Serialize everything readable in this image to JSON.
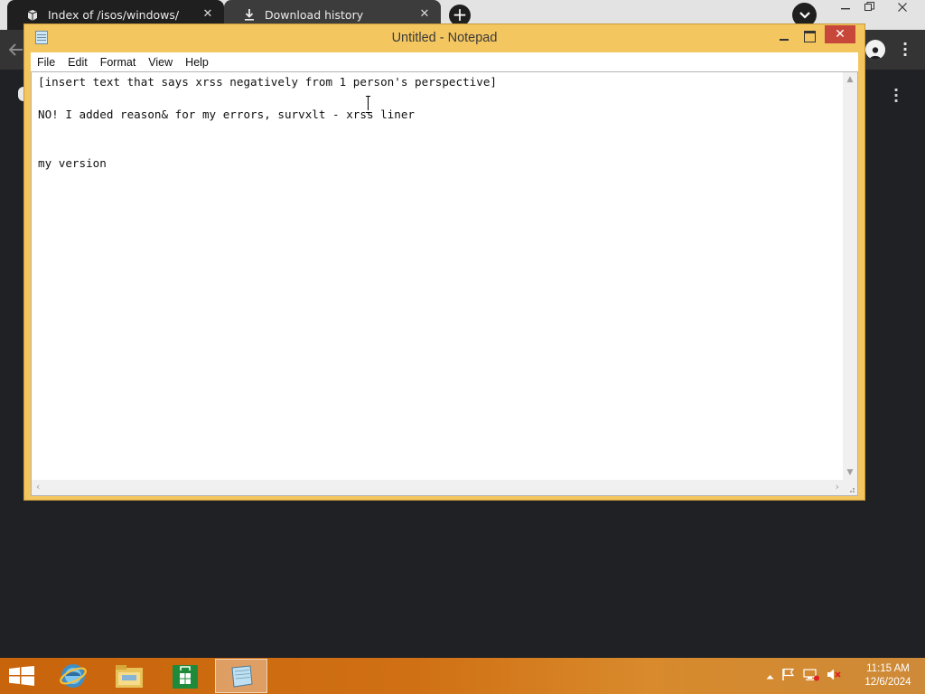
{
  "browser": {
    "tabs": [
      {
        "title": "Index of /isos/windows/",
        "icon": "archive-icon",
        "active": true
      },
      {
        "title": "Download history",
        "icon": "download-icon",
        "active": false
      }
    ],
    "new_tab_icon": "+",
    "close_glyph": "✕"
  },
  "notepad": {
    "title": "Untitled - Notepad",
    "menu": [
      "File",
      "Edit",
      "Format",
      "View",
      "Help"
    ],
    "content": "[insert text that says xrss negatively from 1 person's perspective]\n\nNO! I added reason& for my errors, survxlt - xrss liner\n\n\nmy version",
    "close_glyph": "✕"
  },
  "taskbar": {
    "apps": [
      {
        "name": "Internet Explorer",
        "icon": "ie-icon",
        "active": false
      },
      {
        "name": "File Explorer",
        "icon": "folder-icon",
        "active": false
      },
      {
        "name": "Store",
        "icon": "store-icon",
        "active": false
      },
      {
        "name": "Notepad",
        "icon": "notepad-icon",
        "active": true
      }
    ],
    "clock": {
      "time": "11:15 AM",
      "date": "12/6/2024"
    }
  },
  "colors": {
    "accent_window": "#f3c660",
    "close_red": "#c7473a",
    "taskbar_orange": "#c8640c"
  }
}
